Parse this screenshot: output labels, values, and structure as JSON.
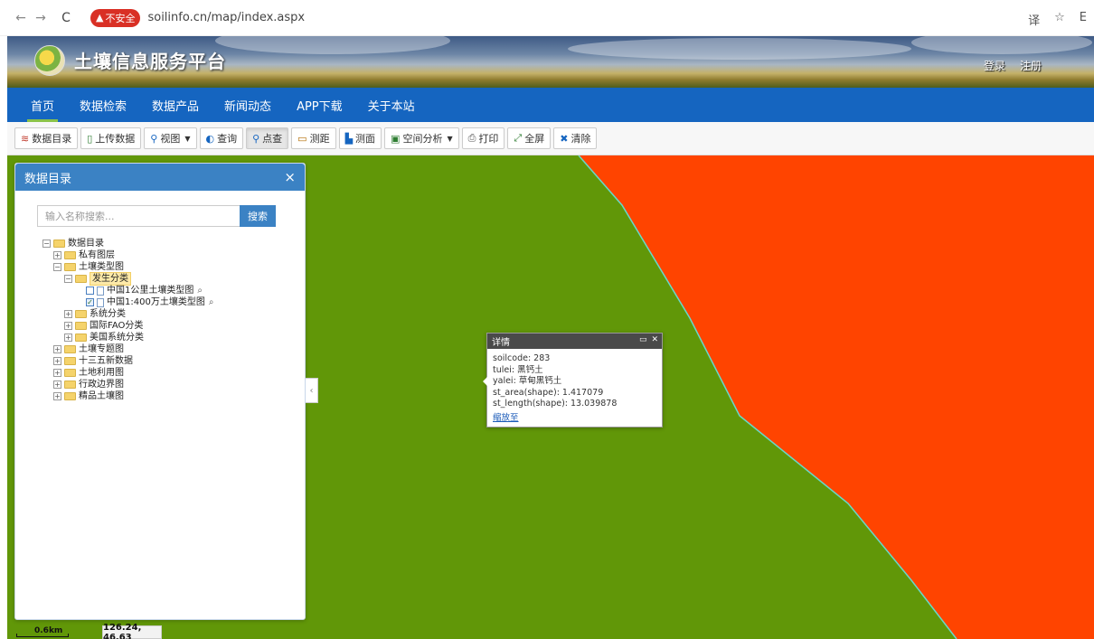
{
  "browser": {
    "back_icon": "←",
    "forward_icon": "→",
    "reload_icon": "C",
    "insecure_label": "不安全",
    "url": "soilinfo.cn/map/index.aspx",
    "translate_icon": "译",
    "star_icon": "☆",
    "ext_icon": "E"
  },
  "header": {
    "site_title": "土壤信息服务平台",
    "login": "登录",
    "register": "注册"
  },
  "nav": {
    "items": [
      {
        "label": "首页"
      },
      {
        "label": "数据检索"
      },
      {
        "label": "数据产品"
      },
      {
        "label": "新闻动态"
      },
      {
        "label": "APP下载"
      },
      {
        "label": "关于本站"
      }
    ]
  },
  "toolbar": {
    "data_catalog": "数据目录",
    "upload": "上传数据",
    "view": "视图",
    "query": "查询",
    "point_query": "点查",
    "measure_distance": "测距",
    "measure_area": "测面",
    "spatial_analysis": "空间分析",
    "print": "打印",
    "fullscreen": "全屏",
    "clear": "清除"
  },
  "panel": {
    "title": "数据目录",
    "close": "×",
    "search_placeholder": "输入名称搜索...",
    "search_button": "搜索",
    "tree": {
      "root": "数据目录",
      "private_layers": "私有图层",
      "soil_type_maps": "土壤类型图",
      "genetic_class": "发生分类",
      "layer_1km": "中国1公里土壤类型图",
      "layer_4m": "中国1:400万土壤类型图",
      "systematic_class": "系统分类",
      "fao_class": "国际FAO分类",
      "us_class": "美国系统分类",
      "thematic_maps": "土壤专题图",
      "fyp13": "十三五新数据",
      "land_use": "土地利用图",
      "admin_boundary": "行政边界图",
      "premium_soil": "精品土壤图"
    }
  },
  "popup": {
    "title": "详情",
    "soilcode": "soilcode: 283",
    "tulei": "tulei: 黑钙土",
    "yalei": "yalei: 草甸黑钙土",
    "st_area": "st_area(shape): 1.417079",
    "st_length": "st_length(shape): 13.039878",
    "zoom_link": "缩放至"
  },
  "status": {
    "scale": "0.6km",
    "coords": "126.24, 46.63"
  },
  "colors": {
    "map_green": "#619708",
    "map_orange": "#ff4400",
    "boundary": "#66d9c9",
    "nav_blue": "#1565c0"
  }
}
